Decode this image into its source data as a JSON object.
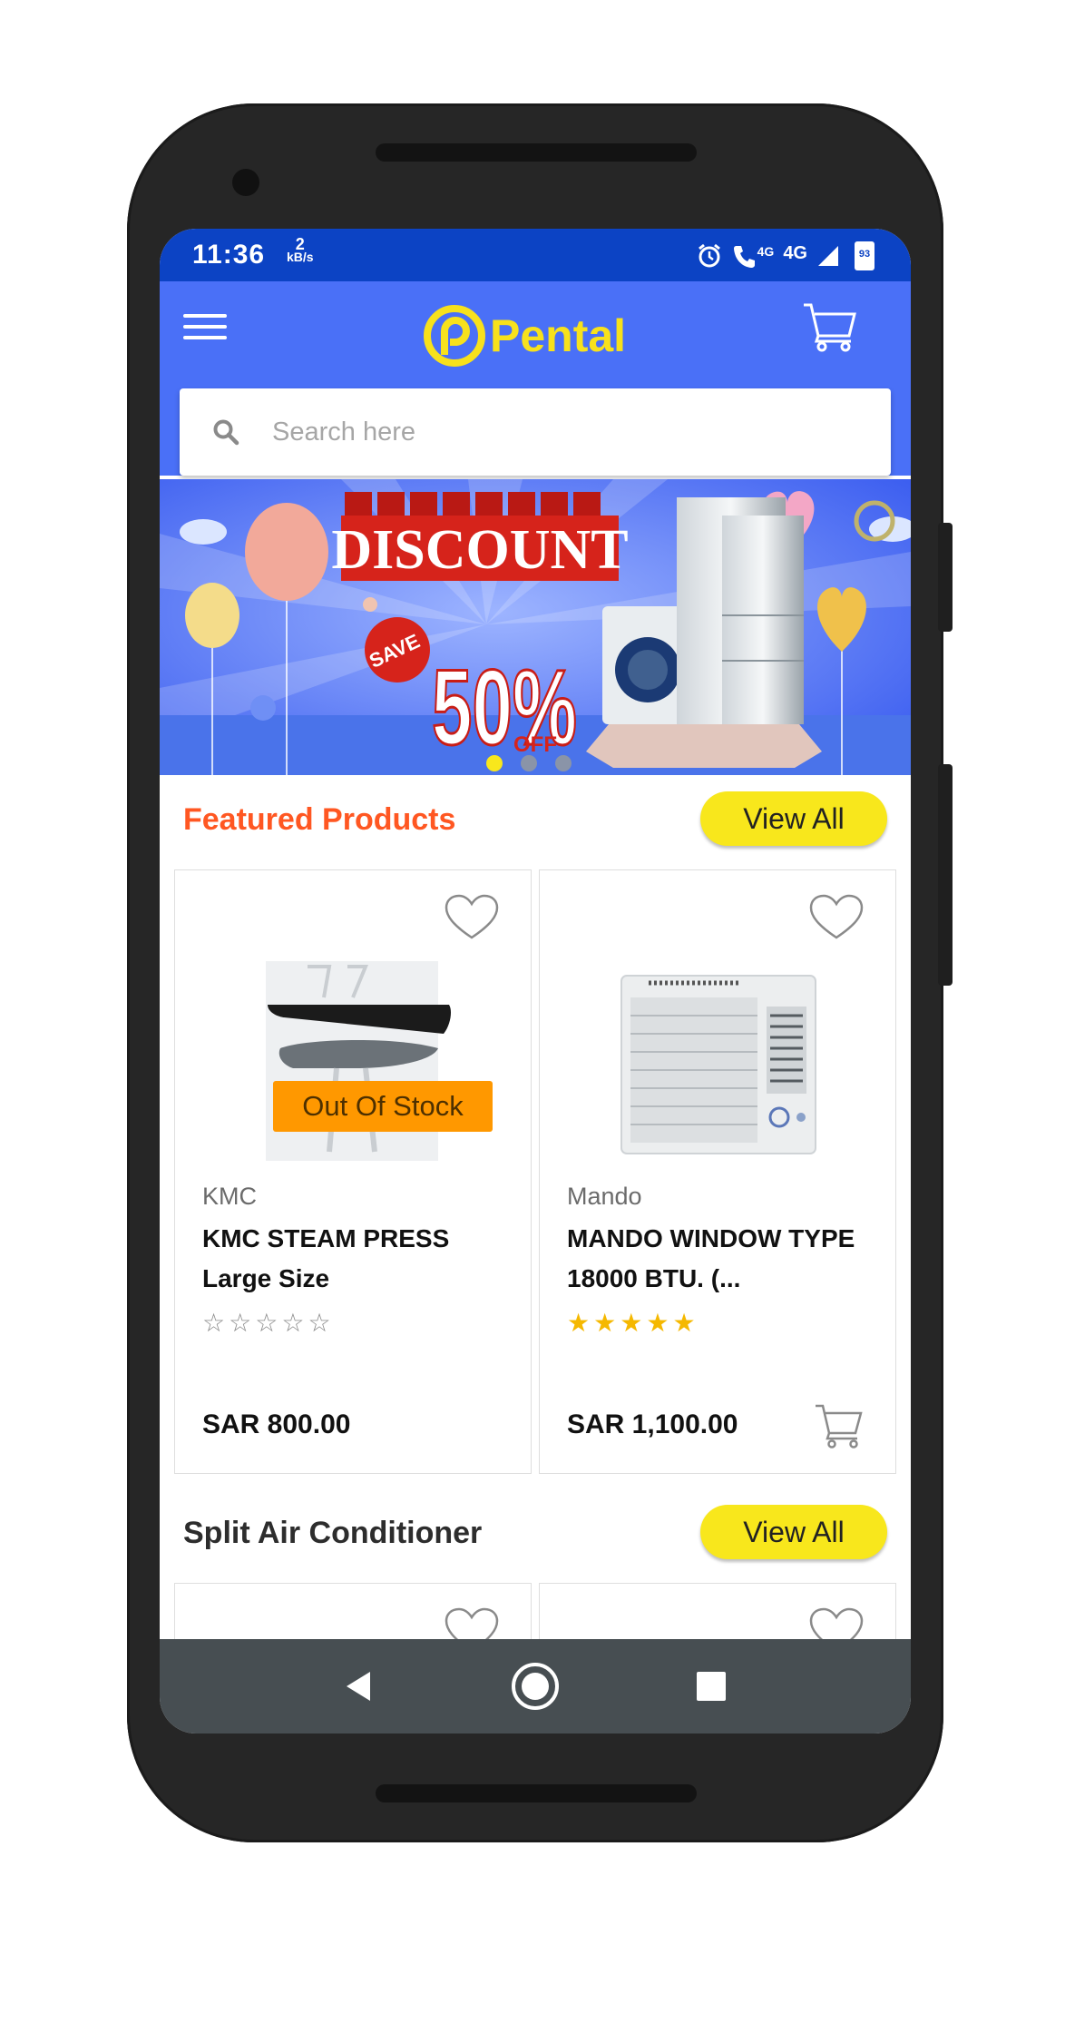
{
  "status_bar": {
    "time": "11:36",
    "speed_value": "2",
    "speed_unit": "kB/s",
    "network_label": "4G",
    "network_small": "4G",
    "battery": "93"
  },
  "app": {
    "logo_text": "Pental",
    "search_placeholder": "Search here"
  },
  "banner": {
    "headline": "DISCOUNT",
    "save_label": "SAVE",
    "percent": "50%",
    "off_label": "OFF",
    "dots": 3,
    "active_dot": 0
  },
  "featured": {
    "title": "Featured Products",
    "view_all": "View All",
    "products": [
      {
        "brand": "KMC",
        "name": "KMC STEAM PRESS Large Size",
        "rating": 0,
        "price": "SAR 800.00",
        "badge": "Out Of Stock"
      },
      {
        "brand": "Mando",
        "name": "MANDO WINDOW TYPE 18000 BTU. (...",
        "rating": 5,
        "price": "SAR 1,100.00"
      }
    ]
  },
  "split": {
    "title": "Split Air Conditioner",
    "view_all": "View All"
  },
  "colors": {
    "status_bar": "#0c43c4",
    "app_bar": "#4a70f7",
    "logo": "#f7e11c",
    "featured_title": "#ff5722",
    "button": "#f8e71c",
    "star": "#f5b800",
    "out_of_stock": "#ff9800"
  }
}
